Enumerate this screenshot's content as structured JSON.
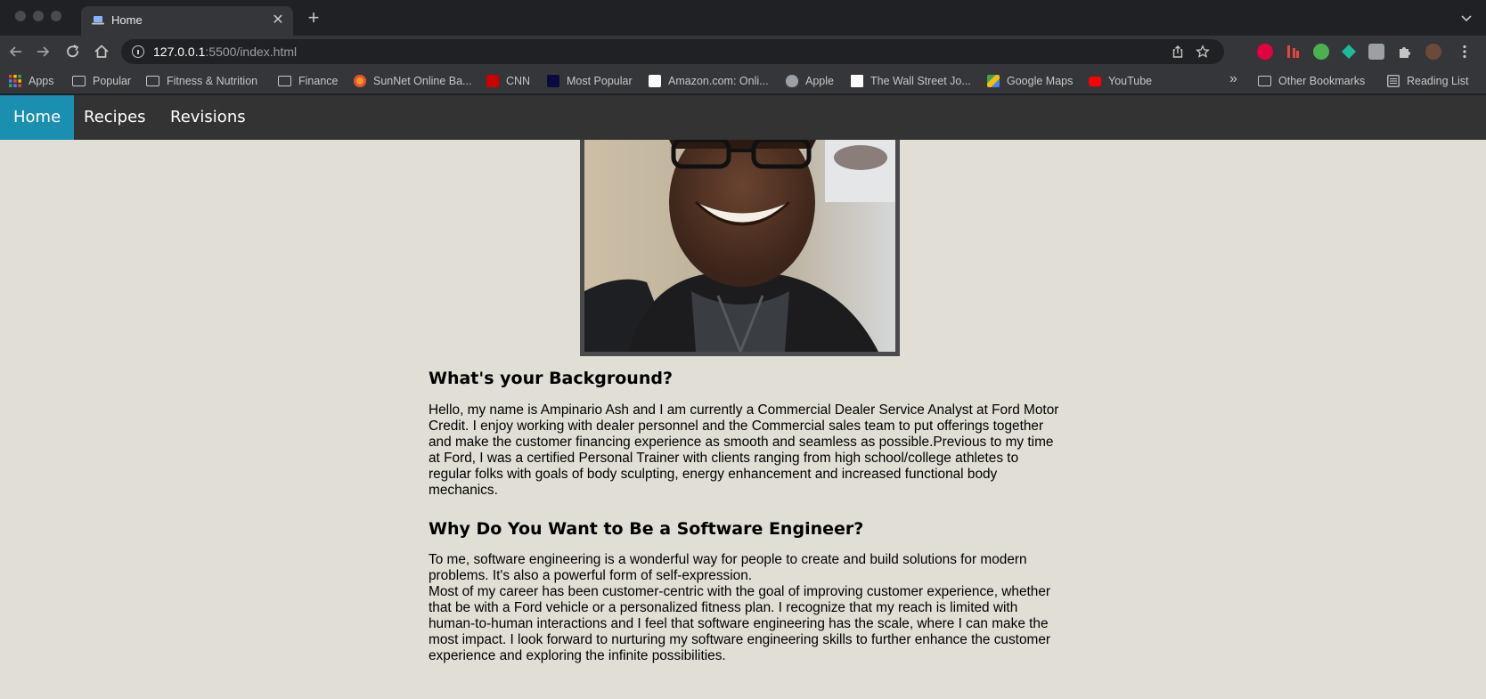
{
  "browser": {
    "tab": {
      "title": "Home"
    },
    "toolbar": {
      "url_host": "127.0.0.1",
      "url_rest": ":5500/index.html"
    },
    "bookmarks": {
      "apps": "Apps",
      "items": [
        "Popular",
        "Fitness & Nutrition",
        "Finance",
        "SunNet Online Ba...",
        "CNN",
        "Most Popular",
        "Amazon.com: Onli...",
        "Apple",
        "The Wall Street Jo...",
        "Google Maps",
        "YouTube"
      ],
      "other": "Other Bookmarks",
      "reading_list": "Reading List"
    }
  },
  "site": {
    "nav": [
      "Home",
      "Recipes",
      "Revisions"
    ],
    "sections": [
      {
        "heading": "What's your Background?",
        "paragraphs": [
          "Hello, my name is Ampinario Ash and I am currently a Commercial Dealer Service Analyst at Ford Motor Credit. I enjoy working with dealer personnel and the Commercial sales team to put offerings together and make the customer financing experience as smooth and seamless as possible.Previous to my time at Ford, I was a certified Personal Trainer with clients ranging from high school/college athletes to regular folks with goals of body sculpting, energy enhancement and increased functional body mechanics."
        ]
      },
      {
        "heading": "Why Do You Want to Be a Software Engineer?",
        "paragraphs": [
          "To me, software engineering is a wonderful way for people to create and build solutions for modern problems. It's also a powerful form of self-expression.",
          "Most of my career has been customer-centric with the goal of improving customer experience, whether that be with a Ford vehicle or a personalized fitness plan. I recognize that my reach is limited with human-to-human interactions and I feel that software engineering has the scale, where I can make the most impact. I look forward to nurturing my software engineering skills to further enhance the customer experience and exploring the infinite possibilities."
        ]
      }
    ]
  },
  "colors": {
    "nav_bg": "#333333",
    "nav_active": "#1a8fb0",
    "page_bg": "#e0ded5"
  }
}
